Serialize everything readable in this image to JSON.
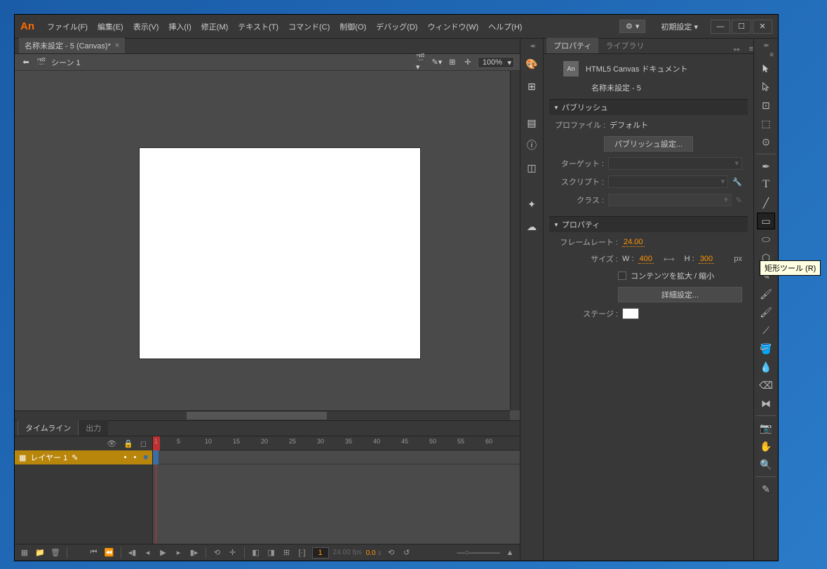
{
  "app": {
    "logo": "An"
  },
  "menu": {
    "file": "ファイル(F)",
    "edit": "編集(E)",
    "view": "表示(V)",
    "insert": "挿入(I)",
    "modify": "修正(M)",
    "text": "テキスト(T)",
    "commands": "コマンド(C)",
    "control": "制御(O)",
    "debug": "デバッグ(D)",
    "window": "ウィンドウ(W)",
    "help": "ヘルプ(H)"
  },
  "workspace": "初期設定",
  "docTab": "名称未設定 - 5 (Canvas)*",
  "scene": "シーン 1",
  "zoom": "100%",
  "timeline": {
    "tab1": "タイムライン",
    "tab2": "出力",
    "layer": "レイヤー 1",
    "ticks": [
      "1",
      "5",
      "10",
      "15",
      "20",
      "25",
      "30",
      "35",
      "40",
      "45",
      "50",
      "55",
      "60"
    ],
    "frame": "1",
    "fps": "24.00 fps",
    "time": "0.0",
    "timeUnit": "s"
  },
  "props": {
    "tab1": "プロパティ",
    "tab2": "ライブラリ",
    "docType": "HTML5 Canvas ドキュメント",
    "docIconLabel": "An",
    "docName": "名称未設定 - 5",
    "publishSection": "パブリッシュ",
    "profileLabel": "プロファイル :",
    "profileValue": "デフォルト",
    "publishSettingsBtn": "パブリッシュ設定...",
    "targetLabel": "ターゲット :",
    "scriptLabel": "スクリプト :",
    "classLabel": "クラス :",
    "propsSection": "プロパティ",
    "frameRateLabel": "フレームレート :",
    "frameRateValue": "24.00",
    "sizeLabel": "サイズ :",
    "wLabel": "W :",
    "wValue": "400",
    "hLabel": "H :",
    "hValue": "300",
    "pxLabel": "px",
    "scaleContentLabel": "コンテンツを拡大 / 縮小",
    "advancedBtn": "詳細設定...",
    "stageLabel": "ステージ :"
  },
  "tooltip": "矩形ツール (R)"
}
